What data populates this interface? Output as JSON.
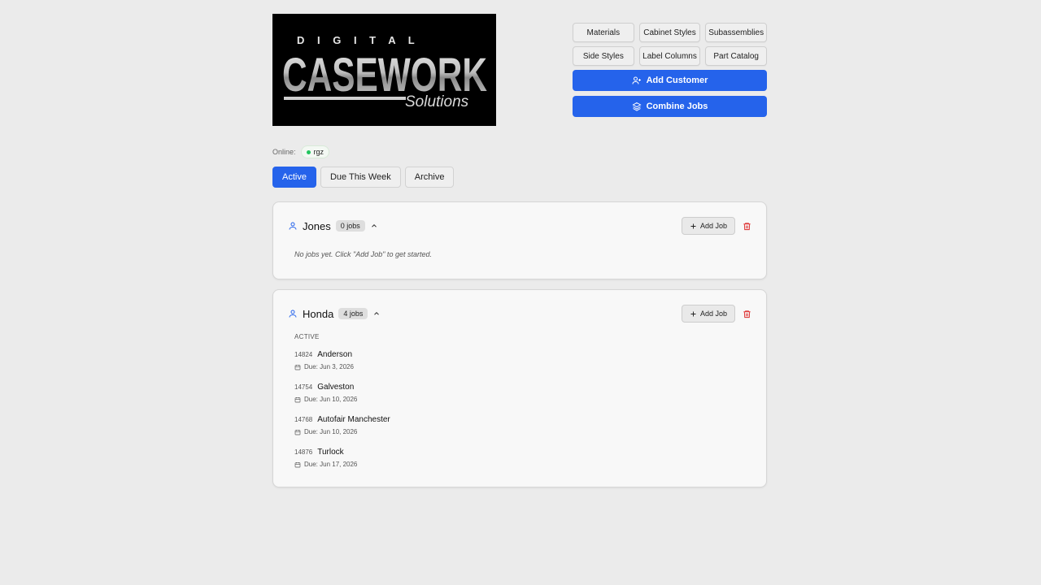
{
  "logo": {
    "top_text": "D I G I T A L",
    "main_text": "CASEWORK",
    "sub_text": "Solutions"
  },
  "toolbar": {
    "row1": [
      "Materials",
      "Cabinet Styles",
      "Subassemblies"
    ],
    "row2": [
      "Side Styles",
      "Label Columns",
      "Part Catalog"
    ],
    "add_customer": "Add Customer",
    "combine_jobs": "Combine Jobs"
  },
  "online": {
    "label": "Online:",
    "user": "rgz"
  },
  "tabs": [
    {
      "label": "Active",
      "active": true
    },
    {
      "label": "Due This Week",
      "active": false
    },
    {
      "label": "Archive",
      "active": false
    }
  ],
  "customers": [
    {
      "name": "Jones",
      "count": "0 jobs",
      "add_job": "Add Job",
      "empty_message": "No jobs yet. Click \"Add Job\" to get started."
    },
    {
      "name": "Honda",
      "count": "4 jobs",
      "add_job": "Add Job",
      "section": "ACTIVE",
      "jobs": [
        {
          "number": "14824",
          "name": "Anderson",
          "due": "Due: Jun 3, 2026"
        },
        {
          "number": "14754",
          "name": "Galveston",
          "due": "Due: Jun 10, 2026"
        },
        {
          "number": "14768",
          "name": "Autofair Manchester",
          "due": "Due: Jun 10, 2026"
        },
        {
          "number": "14876",
          "name": "Turlock",
          "due": "Due: Jun 17, 2026"
        }
      ]
    }
  ],
  "colors": {
    "accent": "#2563eb",
    "online_dot": "#22c55e",
    "danger": "#dc2626"
  }
}
